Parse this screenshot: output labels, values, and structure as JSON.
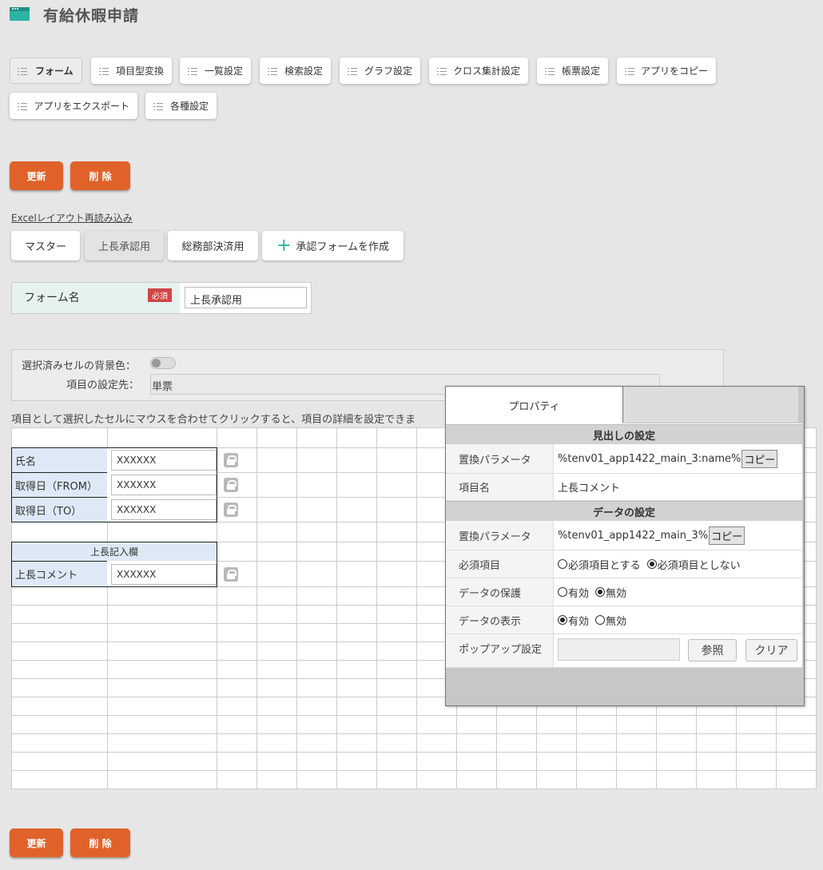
{
  "header": {
    "title": "有給休暇申請",
    "app_icon": "app-window-icon",
    "accent_color": "#2bb3a4"
  },
  "menu": {
    "row1": [
      "フォーム",
      "項目型変換",
      "一覧設定",
      "検索設定",
      "グラフ設定",
      "クロス集計設定",
      "帳票設定",
      "アプリをコピー"
    ],
    "row2": [
      "アプリをエクスポート",
      "各種設定"
    ],
    "active": "フォーム"
  },
  "actions": {
    "update_label": "更新",
    "delete_label": "削 除",
    "button_color": "#e0622a"
  },
  "excel_link": "Excelレイアウト再読み込み",
  "form_tabs": {
    "items": [
      "マスター",
      "上長承認用",
      "総務部決済用"
    ],
    "active": "上長承認用",
    "create_label": "承認フォームを作成"
  },
  "form_name": {
    "label": "フォーム名",
    "required_badge": "必須",
    "value": "上長承認用"
  },
  "settings": {
    "bg_color_label": "選択済みセルの背景色：",
    "bg_color_enabled": false,
    "target_label": "項目の設定先：",
    "target_value": "単票"
  },
  "instruction": "項目として選択したセルにマウスを合わせてクリックすると、項目の詳細を設定できま",
  "sheet": {
    "rows": [
      {
        "label": "氏名",
        "value": "XXXXXX"
      },
      {
        "label": "取得日（FROM）",
        "value": "XXXXXX"
      },
      {
        "label": "取得日（TO）",
        "value": "XXXXXX"
      }
    ],
    "section_header": "上長記入欄",
    "section_rows": [
      {
        "label": "上長コメント",
        "value": "XXXXXX"
      }
    ]
  },
  "property_dialog": {
    "tab_label": "プロパティ",
    "heading_section": "見出しの設定",
    "heading_param_label": "置換パラメータ",
    "heading_param_value": "%tenv01_app1422_main_3:name%",
    "item_name_label": "項目名",
    "item_name_value": "上長コメント",
    "data_section": "データの設定",
    "data_param_label": "置換パラメータ",
    "data_param_value": "%tenv01_app1422_main_3%",
    "copy_label": "コピー",
    "required_label": "必須項目",
    "required_options": [
      "必須項目とする",
      "必須項目としない"
    ],
    "required_selected": "必須項目としない",
    "protect_label": "データの保護",
    "protect_options": [
      "有効",
      "無効"
    ],
    "protect_selected": "無効",
    "display_label": "データの表示",
    "display_options": [
      "有効",
      "無効"
    ],
    "display_selected": "有効",
    "popup_label": "ポップアップ設定",
    "popup_value": "",
    "browse_label": "参照",
    "clear_label": "クリア"
  }
}
